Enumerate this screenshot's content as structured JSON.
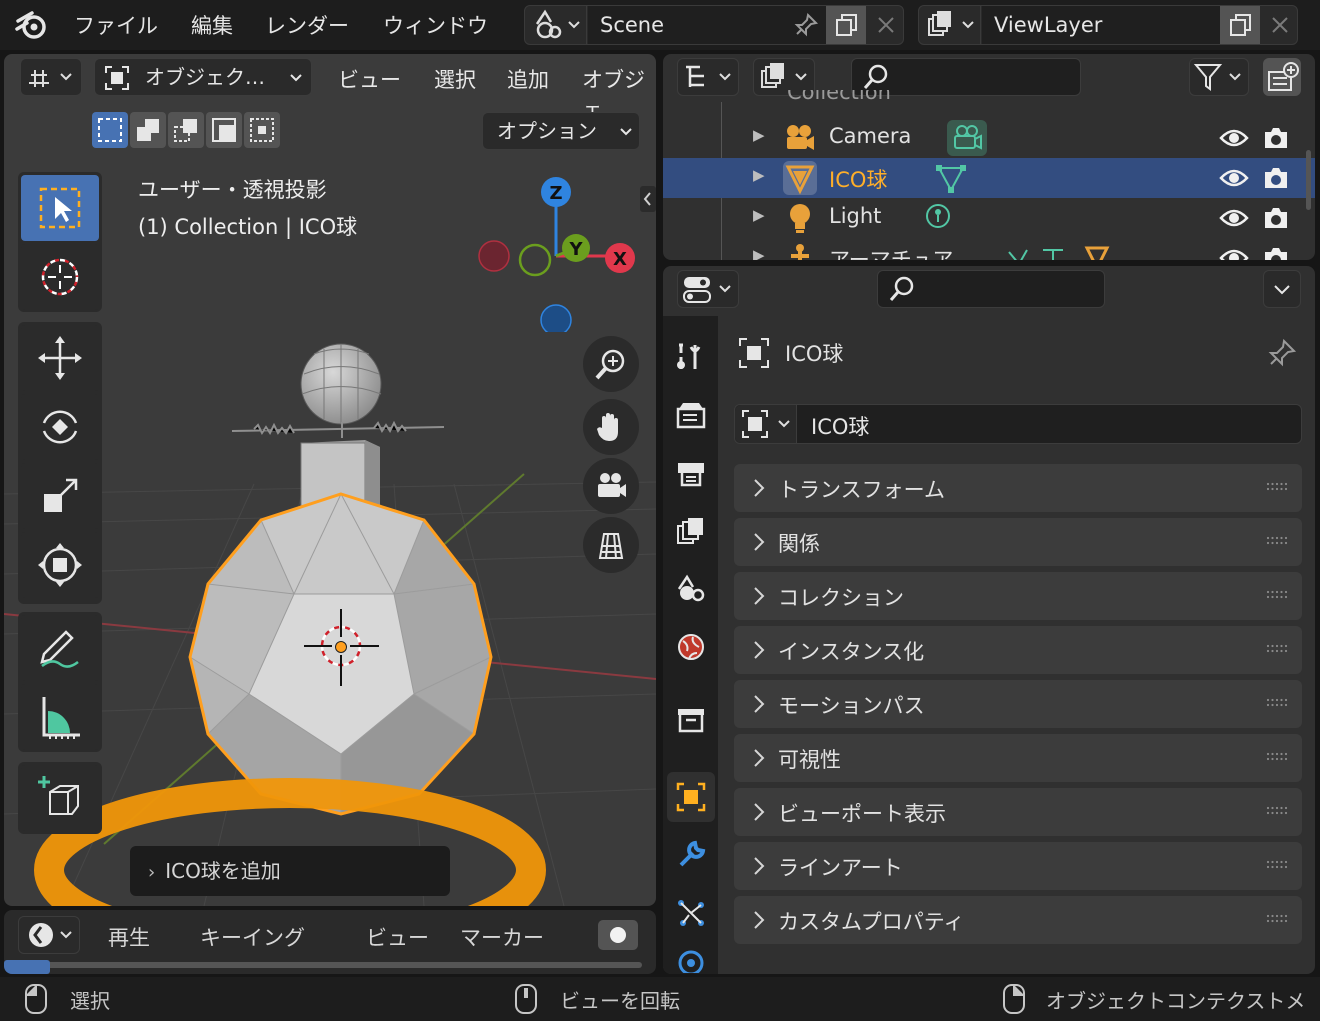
{
  "topbar": {
    "menus": [
      "ファイル",
      "編集",
      "レンダー",
      "ウィンドウ"
    ],
    "scene_name": "Scene",
    "view_layer_name": "ViewLayer"
  },
  "viewport": {
    "header": {
      "mode_label": "オブジェク…",
      "menus": [
        "ビュー",
        "選択",
        "追加",
        "オブジェ"
      ],
      "options_label": "オプション"
    },
    "overlay_title": "ユーザー・透視投影",
    "overlay_subtitle": "(1) Collection | ICO球",
    "gizmo_axes": {
      "z": "Z",
      "y": "Y",
      "x": "X"
    },
    "redo_panel_label": "ICO球を追加",
    "highlight_color": "#f0960a"
  },
  "timeline": {
    "menus": [
      "再生",
      "キーイング",
      "ビュー",
      "マーカー"
    ]
  },
  "outliner": {
    "partial_top_label": "Collection",
    "items": [
      {
        "label": "Camera",
        "icon": "camera-icon",
        "selected": false
      },
      {
        "label": "ICO球",
        "icon": "mesh-icon",
        "selected": true
      },
      {
        "label": "Light",
        "icon": "light-icon",
        "selected": false
      },
      {
        "label": "アーマチュア",
        "icon": "armature-icon",
        "selected": false
      }
    ]
  },
  "properties": {
    "object_title": "ICO球",
    "object_name_field": "ICO球",
    "panels": [
      "トランスフォーム",
      "関係",
      "コレクション",
      "インスタンス化",
      "モーションパス",
      "可視性",
      "ビューポート表示",
      "ラインアート",
      "カスタムプロパティ"
    ],
    "tabs": [
      "tool-icon",
      "render-icon",
      "output-icon",
      "view-layer-icon",
      "scene-icon",
      "world-icon",
      "collection-icon",
      "object-icon",
      "modifier-icon",
      "particles-icon",
      "physics-icon"
    ],
    "active_tab": "object-icon"
  },
  "statusbar": {
    "left": "選択",
    "middle": "ビューを回転",
    "right": "オブジェクトコンテクストメ"
  },
  "colors": {
    "accent_blue": "#4772b3",
    "selection_orange": "#ffaf29",
    "axis_x": "#e0384c",
    "axis_y": "#6b9e1e",
    "axis_z": "#2f84e0"
  }
}
